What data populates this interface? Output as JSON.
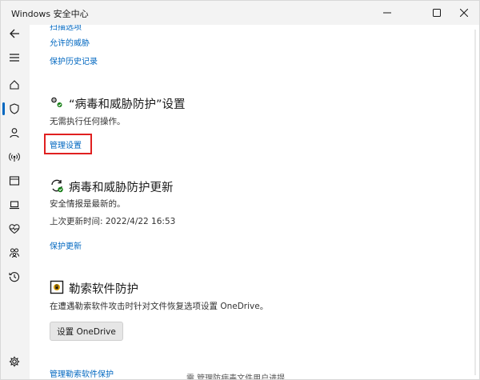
{
  "window": {
    "title": "Windows 安全中心"
  },
  "nav": {
    "back": "back-icon",
    "menu": "hamburger-icon",
    "items": [
      "home-icon",
      "shield-icon",
      "person-icon",
      "wireless-icon",
      "app-browser-icon",
      "laptop-icon",
      "health-icon",
      "family-icon",
      "history-icon"
    ],
    "settings": "gear-icon"
  },
  "top_links": {
    "scan_options": "扫描选项",
    "allowed_threats": "允许的威胁",
    "protection_history": "保护历史记录"
  },
  "virus_settings": {
    "title": "“病毒和威胁防护”设置",
    "desc": "无需执行任何操作。",
    "link": "管理设置"
  },
  "virus_updates": {
    "title": "病毒和威胁防护更新",
    "status": "安全情报是最新的。",
    "last_update": "上次更新时间: 2022/4/22 16:53",
    "link": "保护更新"
  },
  "ransomware": {
    "title": "勒索软件防护",
    "desc": "在遭遇勒索软件攻击时针对文件恢复选项设置 OneDrive。",
    "button": "设置 OneDrive",
    "link": "管理勒索软件保护",
    "cut_text": "需 管理防病毒文件用户进提"
  },
  "colors": {
    "accent": "#0067c0",
    "highlight": "#e02020",
    "sidebar_bg": "#f3f3f3"
  }
}
